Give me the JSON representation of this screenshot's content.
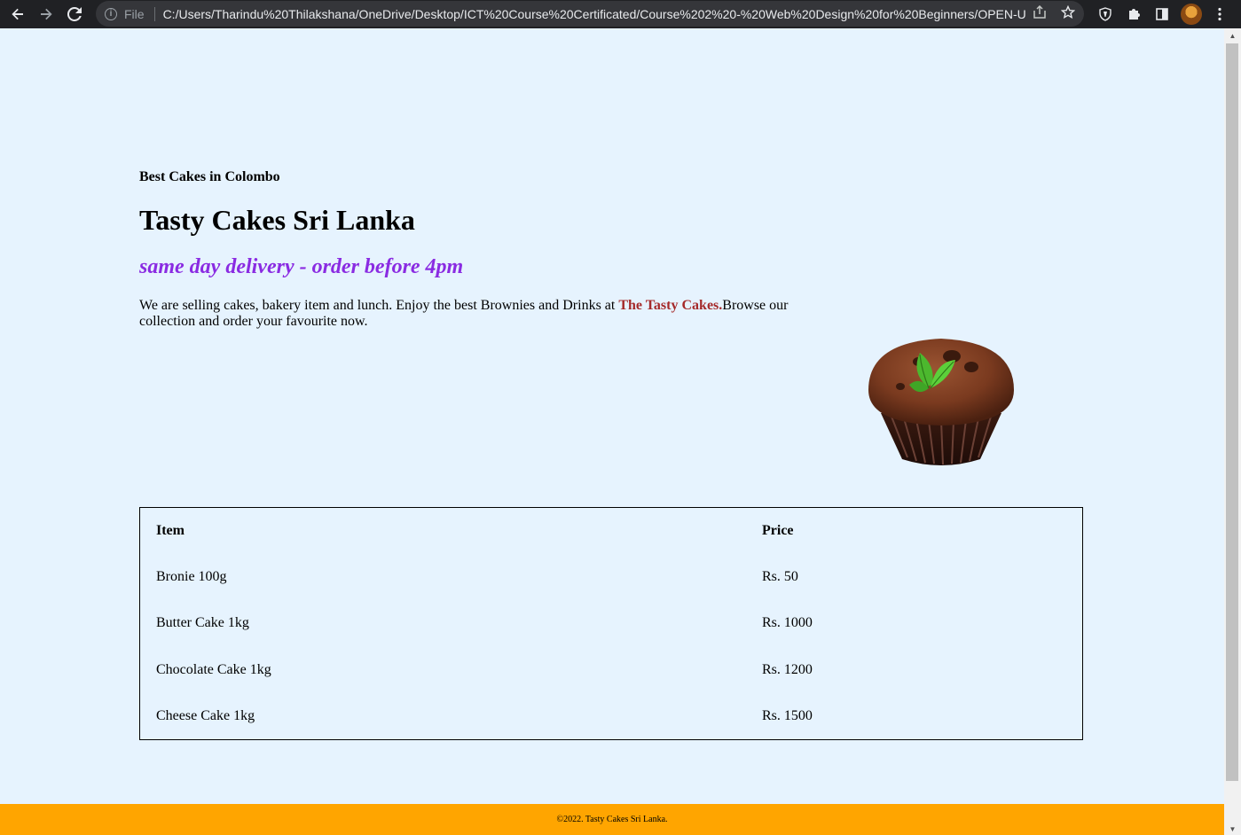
{
  "browser": {
    "file_label": "File",
    "url": "C:/Users/Tharindu%20Thilakshana/OneDrive/Desktop/ICT%20Course%20Certificated/Course%202%20-%20Web%20Design%20for%20Beginners/OPEN-UO...",
    "icons": [
      "back-icon",
      "forward-icon",
      "reload-icon",
      "info-icon",
      "share-icon",
      "star-icon",
      "shield-icon",
      "puzzle-icon",
      "sidepanel-icon",
      "menu-icon"
    ]
  },
  "page": {
    "tagline": "Best Cakes in Colombo",
    "title": "Tasty Cakes Sri Lanka",
    "delivery": "same day delivery - order before 4pm",
    "intro_before": "We are selling cakes, bakery item and lunch. Enjoy the best Brownies and Drinks at ",
    "brand": "The Tasty Cakes.",
    "intro_after": "Browse our collection and order your favourite now.",
    "image_alt": "chocolate cupcake with mint leaf"
  },
  "menu": {
    "headers": {
      "item": "Item",
      "price": "Price"
    },
    "rows": [
      {
        "item": "Bronie 100g",
        "price": "Rs. 50"
      },
      {
        "item": "Butter Cake 1kg",
        "price": "Rs. 1000"
      },
      {
        "item": "Chocolate Cake 1kg",
        "price": "Rs. 1200"
      },
      {
        "item": "Cheese Cake 1kg",
        "price": "Rs. 1500"
      }
    ]
  },
  "footer": {
    "text": "©2022. Tasty Cakes Sri Lanka."
  },
  "colors": {
    "background": "#e6f3fe",
    "accent": "#8a2be2",
    "brand": "#a52a2a",
    "footer": "#ffa500"
  }
}
